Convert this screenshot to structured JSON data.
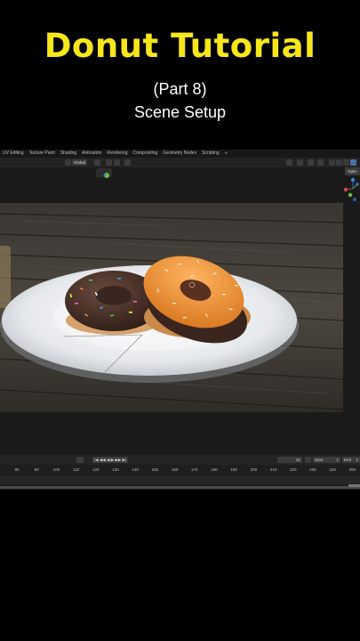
{
  "overlay": {
    "title": "Donut Tutorial",
    "subtitle": "(Part 8)",
    "subtitle2": "Scene Setup"
  },
  "workspace_tabs": [
    "UV Editing",
    "Texture Paint",
    "Shading",
    "Animation",
    "Rendering",
    "Compositing",
    "Geometry Nodes",
    "Scripting"
  ],
  "workspace_add": "+",
  "header": {
    "orientation": "Global",
    "options_label": "Optio"
  },
  "timeline": {
    "controls": "|◀ ◀◀ ◀ ▶ ▶▶ ▶|",
    "current_frame": "31",
    "start_label": "Start",
    "start_value": "1",
    "end_label": "End",
    "end_value": "1",
    "ticks": [
      "80",
      "90",
      "100",
      "110",
      "120",
      "130",
      "140",
      "150",
      "160",
      "170",
      "180",
      "190",
      "200",
      "210",
      "220",
      "230",
      "240",
      "250"
    ]
  },
  "colors": {
    "title": "#f7e619",
    "gizmo_x": "#d24b4b",
    "gizmo_y": "#6fbf3a",
    "gizmo_z": "#3f7fd6"
  }
}
